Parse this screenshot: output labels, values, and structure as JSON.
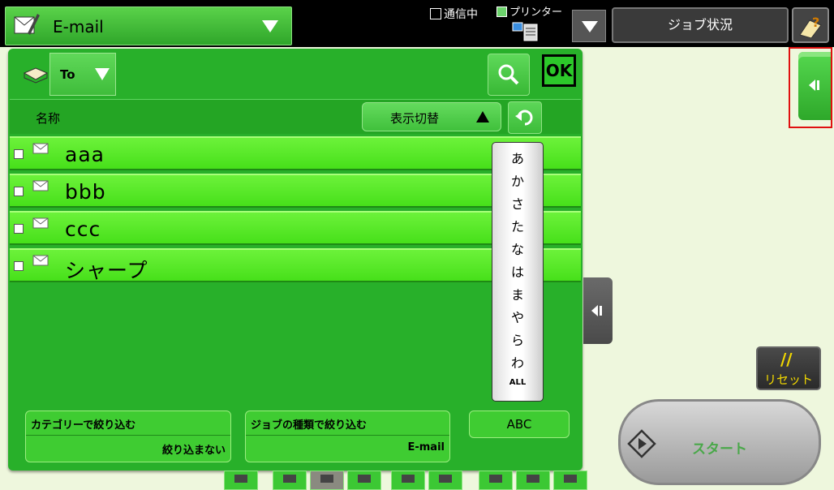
{
  "header": {
    "mode_label": "E-mail",
    "status_comm": "通信中",
    "status_printer": "プリンター",
    "job_status_label": "ジョブ状況"
  },
  "panel": {
    "to_label": "To",
    "ok_label": "OK",
    "column_name": "名称",
    "view_switch_label": "表示切替",
    "rows": [
      {
        "name": "aaa"
      },
      {
        "name": "bbb"
      },
      {
        "name": "ccc"
      },
      {
        "name": "シャープ"
      }
    ],
    "index_keys": [
      "あ",
      "か",
      "さ",
      "た",
      "な",
      "は",
      "ま",
      "や",
      "ら",
      "わ",
      "ALL"
    ],
    "filter_category_title": "カテゴリーで絞り込む",
    "filter_category_value": "絞り込まない",
    "filter_jobtype_title": "ジョブの種類で絞り込む",
    "filter_jobtype_value": "E-mail",
    "abc_label": "ABC"
  },
  "side": {
    "reset_label": "リセット",
    "start_label": "スタート"
  },
  "colors": {
    "panel_green": "#28b02a",
    "row_green": "#55e820",
    "highlight_red": "#e01010",
    "reset_yellow": "#f2d800"
  },
  "icons": [
    "email-mode-icon",
    "printer-icon",
    "help-icon",
    "address-book-icon",
    "search-icon",
    "undo-icon",
    "checkbox-icon",
    "mail-icon",
    "collapse-left-icon",
    "start-icon"
  ]
}
